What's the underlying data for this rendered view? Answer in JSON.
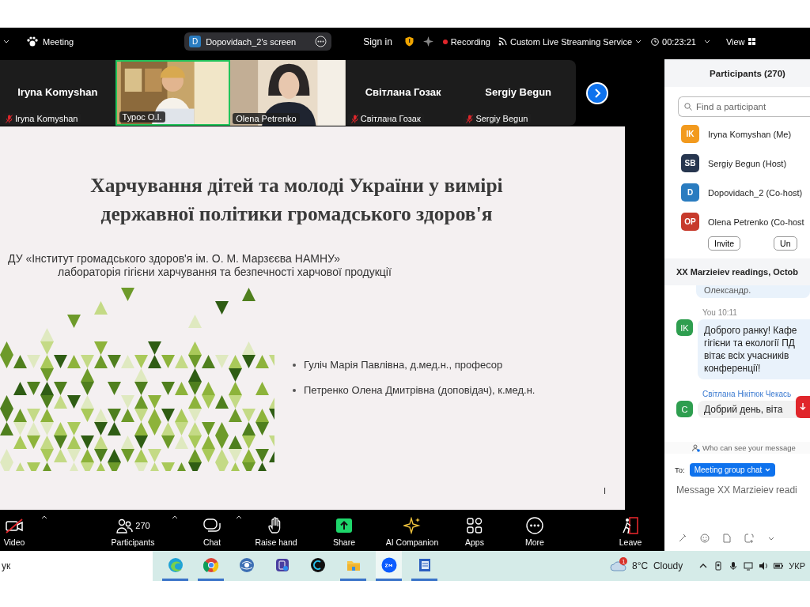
{
  "top_bar": {
    "meeting_label": "Meeting",
    "screen_share": {
      "avatar": "D",
      "label": "Dopovidach_2's screen"
    },
    "sign_in": "Sign in",
    "recording": "Recording",
    "streaming": "Custom Live Streaming Service",
    "timer": "00:23:21",
    "view": "View"
  },
  "video_tiles": [
    {
      "kind": "name",
      "name": "Iryna Komyshan",
      "label": "Iryna Komyshan",
      "muted": true,
      "selected": false
    },
    {
      "kind": "video",
      "label": "Турос О.І.",
      "muted": false,
      "selected": true
    },
    {
      "kind": "video",
      "label": "Olena Petrenko",
      "muted": false,
      "selected": false
    },
    {
      "kind": "name",
      "name": "Світлана Гозак",
      "label": "Світлана Гозак",
      "muted": true,
      "selected": false
    },
    {
      "kind": "name",
      "name": "Sergiy Begun",
      "label": "Sergiy Begun",
      "muted": true,
      "selected": false
    }
  ],
  "slide": {
    "title": [
      "Харчування дітей та молоді України у вимірі",
      "державної політики громадського здоров'я"
    ],
    "institution": "ДУ «Інститут громадського здоров'я ім. О. М. Марзєєва НАМНУ»",
    "lab": "лабораторія гігієни харчування та безпечності харчової продукції",
    "presenters": [
      "Гуліч Марія Павлівна, д.мед.н., професор",
      "Петренко Олена Дмитрівна (доповідач), к.мед.н."
    ],
    "page_mark": "I"
  },
  "toolbar": [
    {
      "label": "Video"
    },
    {
      "label": "Participants",
      "count": "270"
    },
    {
      "label": "Chat"
    },
    {
      "label": "Raise hand"
    },
    {
      "label": "Share"
    },
    {
      "label": "AI Companion"
    },
    {
      "label": "Apps"
    },
    {
      "label": "More"
    },
    {
      "label": "Leave"
    }
  ],
  "participants": {
    "title": "Participants (270)",
    "search": {
      "placeholder": "Find a participant"
    },
    "items": [
      {
        "initials": "IK",
        "name": "Iryna Komyshan (Me)",
        "color": "#f29a1e"
      },
      {
        "initials": "SB",
        "name": "Sergiy Begun (Host)",
        "color": "#27364f"
      },
      {
        "initials": "D",
        "name": "Dopovidach_2 (Co-host)",
        "color": "#2a7cc0"
      },
      {
        "initials": "OP",
        "name": "Olena Petrenko (Co-host",
        "color": "#c73a2c"
      }
    ],
    "buttons": [
      "Invite",
      "Un"
    ]
  },
  "chat": {
    "title": "XX Marzieiev readings, Octob",
    "earlier_message": "Олександр.",
    "messages": [
      {
        "sender": "You",
        "time": "10:11",
        "avatar": "IK",
        "lines": [
          "Доброго ранку! Кафе",
          "гігієни та екології ПД",
          "вітає всіх учасників",
          "конференції!"
        ]
      },
      {
        "sender": "Світлана Нікітюк Чекась",
        "avatar": "C",
        "lines": [
          "Добрий день, віта"
        ]
      }
    ],
    "visibility_note": "Who can see your message",
    "to_label": "To:",
    "recipient": "Meeting group chat",
    "input": {
      "placeholder": "Message XX Marzieiev readi"
    }
  },
  "taskbar": {
    "search_text": "ук",
    "weather": "8°C  Cloudy",
    "weather_badge": "1",
    "language": "УКР"
  }
}
